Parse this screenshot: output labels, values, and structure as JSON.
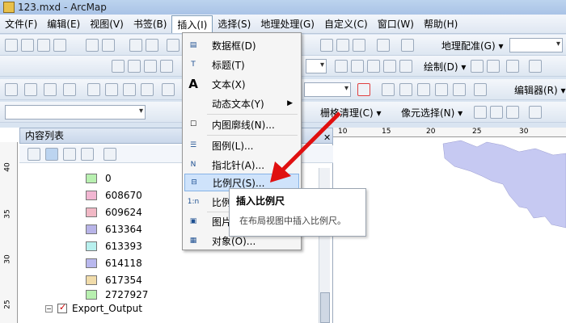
{
  "window": {
    "title": "123.mxd - ArcMap"
  },
  "menubar": {
    "items": [
      "文件(F)",
      "编辑(E)",
      "视图(V)",
      "书签(B)",
      "插入(I)",
      "选择(S)",
      "地理处理(G)",
      "自定义(C)",
      "窗口(W)",
      "帮助(H)"
    ]
  },
  "toolbars": {
    "georef_label": "地理配准(G) ▾",
    "draw_label": "绘制(D) ▾",
    "editor_label": "编辑器(R) ▾",
    "grid_label": "栅格清理(C) ▾",
    "pixel_select_label": "像元选择(N) ▾"
  },
  "toc": {
    "title": "内容列表",
    "legend_items": [
      {
        "label": "0",
        "color": "#b8f0b0"
      },
      {
        "label": "608670",
        "color": "#f2b6d2"
      },
      {
        "label": "609624",
        "color": "#f1b8c5"
      },
      {
        "label": "613364",
        "color": "#b8b4e8"
      },
      {
        "label": "613393",
        "color": "#b8f0ee"
      },
      {
        "label": "614118",
        "color": "#b9b8ee"
      },
      {
        "label": "617354",
        "color": "#f1dcaa"
      },
      {
        "label": "2727927",
        "color": "#b8f0b0"
      }
    ],
    "layer_name": "Export_Output",
    "ruler_ticks": [
      "40",
      "35",
      "30",
      "25"
    ]
  },
  "map": {
    "ruler_ticks": [
      "10",
      "15",
      "20",
      "25",
      "30"
    ],
    "polygon_color": "#c6c9f2"
  },
  "insert_menu": {
    "items": [
      {
        "label": "数据框(D)",
        "icon": "data-frame-icon"
      },
      {
        "label": "标题(T)",
        "icon": "title-icon"
      },
      {
        "label": "文本(X)",
        "icon": "text-icon"
      },
      {
        "label": "动态文本(Y)",
        "icon": "dynamic-text-icon",
        "submenu": true
      },
      {
        "label": "内图廓线(N)...",
        "icon": "neatline-icon"
      },
      {
        "label": "图例(L)...",
        "icon": "legend-icon"
      },
      {
        "label": "指北针(A)...",
        "icon": "north-arrow-icon"
      },
      {
        "label": "比例尺(S)...",
        "icon": "scale-bar-icon",
        "highlight": true
      },
      {
        "label": "比例",
        "icon": "scale-text-icon"
      },
      {
        "label": "图片",
        "icon": "picture-icon"
      },
      {
        "label": "对象(O)...",
        "icon": "object-icon"
      }
    ]
  },
  "tooltip": {
    "title": "插入比例尺",
    "description": "在布局视图中插入比例尺。"
  },
  "colors": {
    "arrow": "#e01010",
    "highlight": "#cfe3fb"
  }
}
